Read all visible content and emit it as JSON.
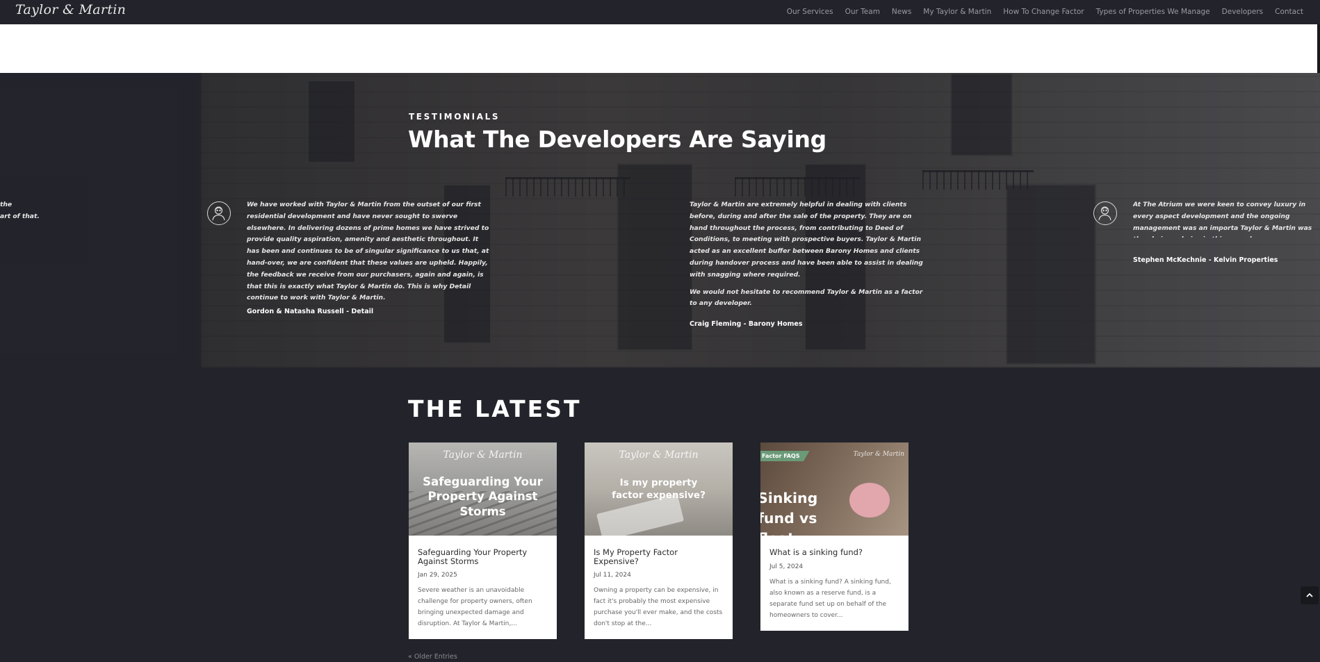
{
  "header": {
    "logo": "Taylor & Martin",
    "nav": [
      "Our Services",
      "Our Team",
      "News",
      "My Taylor & Martin",
      "How To Change Factor",
      "Types of Properties We Manage",
      "Developers",
      "Contact"
    ]
  },
  "testimonials": {
    "eyebrow": "TESTIMONIALS",
    "heading": "What The Developers Are Saying",
    "partial_left": [
      "the",
      "art of that."
    ],
    "items": [
      {
        "paragraphs": [
          "We have worked with Taylor & Martin from the outset of our first residential development and have never sought to swerve elsewhere. In delivering dozens of prime homes we have strived to provide quality aspiration, amenity and aesthetic throughout. It has been and continues to be of singular significance to us that, at hand-over, we are confident that these values are upheld. Happily, the feedback we receive from our purchasers, again and again, is that this is exactly what Taylor & Martin do. This is why Detail continue to work with Taylor & Martin."
        ],
        "author": "Gordon & Natasha Russell - Detail"
      },
      {
        "paragraphs": [
          "Taylor & Martin are extremely helpful in dealing with clients before, during and after the sale of the property. They are on hand throughout the process, from contributing to Deed of Conditions, to meeting with prospective buyers. Taylor & Martin acted as an excellent buffer between Barony Homes and clients during handover process and have been able to assist in dealing with snagging where required.",
          "We would not hesitate to recommend Taylor & Martin as a factor to any developer."
        ],
        "author": "Craig Fleming - Barony Homes"
      },
      {
        "paragraphs": [
          "At The Atrium we were keen to convey luxury in every aspect development and the ongoing management was an importa Taylor & Martin was the obvious choice in this regard."
        ],
        "author": "Stephen McKechnie - Kelvin Properties"
      }
    ]
  },
  "latest": {
    "heading": "THE LATEST",
    "posts": [
      {
        "thumb_logo": "Taylor & Martin",
        "thumb_text": "Safeguarding Your Property Against Storms",
        "title": "Safeguarding Your Property Against Storms",
        "date": "Jan 29, 2025",
        "excerpt": "Severe weather is an unavoidable challenge for property owners, often bringing unexpected damage and disruption. At Taylor & Martin,..."
      },
      {
        "thumb_logo": "Taylor & Martin",
        "thumb_text": "Is my property factor expensive?",
        "title": "Is My Property Factor Expensive?",
        "date": "Jul 11, 2024",
        "excerpt": "Owning a property can be expensive, in fact it's probably the most expensive purchase you'll ever make, and the costs don't stop at the..."
      },
      {
        "thumb_logo": "Taylor & Martin",
        "thumb_badge": "Factor FAQS",
        "thumb_text": "Sinking fund vs float",
        "title": "What is a sinking fund?",
        "date": "Jul 5, 2024",
        "excerpt": "What is a sinking fund? A sinking fund, also known as a reserve fund, is a separate fund set up on behalf of the homeowners to cover..."
      }
    ],
    "older_link": "« Older Entries"
  },
  "icons": {
    "avatar": "person-outline-icon",
    "scroll_top": "chevron-up-icon"
  },
  "colors": {
    "background": "#23242b",
    "badge": "#6b9a78"
  }
}
